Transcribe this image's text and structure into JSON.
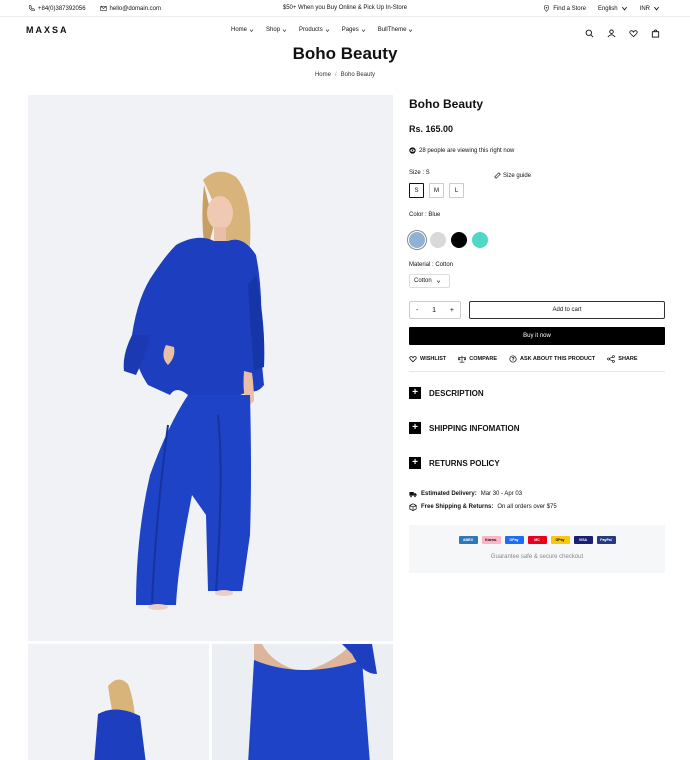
{
  "topbar": {
    "phone": "+84(0)387392056",
    "email": "hello@domain.com",
    "promo": "$50+ When you Buy Online & Pick Up In-Store",
    "find_store": "Find a Store",
    "language": "English",
    "currency": "INR"
  },
  "header": {
    "logo": "MAXSA",
    "nav": [
      "Home",
      "Shop",
      "Products",
      "Pages",
      "BullTheme"
    ]
  },
  "page": {
    "title": "Boho Beauty",
    "breadcrumb": [
      "Home",
      "Boho Beauty"
    ]
  },
  "product": {
    "title": "Boho Beauty",
    "price": "Rs. 165.00",
    "viewing": "28 people are viewing this right now",
    "size_label": "Size : S",
    "size_guide": "Size guide",
    "sizes": [
      "S",
      "M",
      "L"
    ],
    "color_label": "Color : Blue",
    "colors": [
      "#8fb2d4",
      "#d9d9d9",
      "#000000",
      "#4fd8c8"
    ],
    "material_label": "Material : Cotton",
    "material_value": "Cotton",
    "qty": "1",
    "qty_minus": "-",
    "qty_plus": "+",
    "add_to_cart": "Add to cart",
    "buy_now": "Buy it now",
    "actions": [
      "WISHLIST",
      "COMPARE",
      "ASK ABOUT THIS PRODUCT",
      "SHARE"
    ],
    "accordions": [
      "DESCRIPTION",
      "SHIPPING INFOMATION",
      "RETURNS POLICY"
    ],
    "delivery_label": "Estimated Delivery:",
    "delivery_value": "Mar 30 - Apr 03",
    "shipping_label": "Free Shipping & Returns:",
    "shipping_value": "On all orders over $75",
    "payments": [
      "AMEX",
      "Klarna.",
      "OPay",
      "MC",
      "GPay",
      "VISA",
      "PayPal"
    ],
    "guarantee": "Guarantee safe & secure checkout"
  }
}
